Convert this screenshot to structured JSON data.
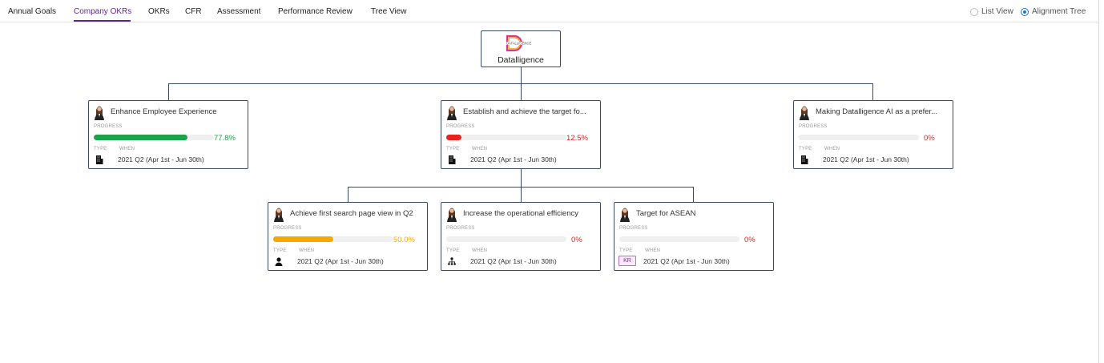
{
  "tabs": [
    {
      "label": "Annual Goals",
      "active": false
    },
    {
      "label": "Company OKRs",
      "active": true
    },
    {
      "label": "OKRs",
      "active": false
    },
    {
      "label": "CFR",
      "active": false
    },
    {
      "label": "Assessment",
      "active": false
    },
    {
      "label": "Performance Review",
      "active": false
    },
    {
      "label": "Tree View",
      "active": false
    }
  ],
  "view_options": {
    "list_view": "List View",
    "alignment_tree": "Alignment Tree",
    "selected": "Alignment Tree"
  },
  "root": {
    "logo_text": "DATALLIGENCE",
    "name": "Datalligence"
  },
  "labels": {
    "progress": "PROGRESS",
    "type": "TYPE",
    "when": "WHEN"
  },
  "cards": [
    {
      "title": "Enhance Employee Experience",
      "progress_pct": 77.8,
      "progress_text": "77.8%",
      "bar_color": "#1aa34a",
      "pct_color": "#1aa34a",
      "type_icon": "building-icon",
      "when": "2021 Q2 (Apr 1st - Jun 30th)"
    },
    {
      "title": "Establish and achieve the target fo...",
      "progress_pct": 12.5,
      "progress_text": "12.5%",
      "bar_color": "#e8211b",
      "pct_color": "#e8211b",
      "type_icon": "building-icon",
      "when": "2021 Q2 (Apr 1st - Jun 30th)"
    },
    {
      "title": "Making Datalligence AI as a prefer...",
      "progress_pct": 0,
      "progress_text": "0%",
      "bar_color": "#e8211b",
      "pct_color": "#e8211b",
      "type_icon": "building-icon",
      "when": "2021 Q2 (Apr 1st - Jun 30th)"
    },
    {
      "title": "Achieve first search page view in Q2",
      "progress_pct": 50.0,
      "progress_text": "50.0%",
      "bar_color": "#f5a800",
      "pct_color": "#f5a800",
      "type_icon": "person-icon",
      "when": "2021 Q2 (Apr 1st - Jun 30th)"
    },
    {
      "title": "Increase the operational efficiency",
      "progress_pct": 0,
      "progress_text": "0%",
      "bar_color": "#e8211b",
      "pct_color": "#e8211b",
      "type_icon": "org-chart-icon",
      "when": "2021 Q2 (Apr 1st - Jun 30th)"
    },
    {
      "title": "Target for ASEAN",
      "progress_pct": 0,
      "progress_text": "0%",
      "bar_color": "#e8211b",
      "pct_color": "#e8211b",
      "type_icon": "kr-badge",
      "type_text": "KR",
      "when": "2021 Q2 (Apr 1st - Jun 30th)"
    }
  ]
}
